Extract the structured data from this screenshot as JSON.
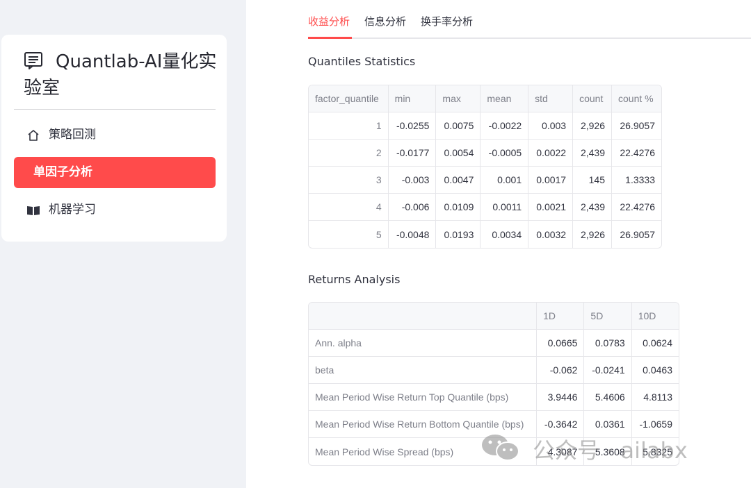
{
  "sidebar": {
    "title": "Quantlab-AI量化实验室",
    "items": [
      {
        "label": "策略回测",
        "icon": "home-icon",
        "active": false
      },
      {
        "label": "单因子分析",
        "icon": "",
        "active": true
      },
      {
        "label": "机器学习",
        "icon": "book-icon",
        "active": false
      }
    ]
  },
  "tabs": [
    {
      "label": "收益分析",
      "active": true
    },
    {
      "label": "信息分析",
      "active": false
    },
    {
      "label": "换手率分析",
      "active": false
    }
  ],
  "quantiles": {
    "title": "Quantiles Statistics",
    "columns": [
      "factor_quantile",
      "min",
      "max",
      "mean",
      "std",
      "count",
      "count %"
    ],
    "rows": [
      [
        "1",
        "-0.0255",
        "0.0075",
        "-0.0022",
        "0.003",
        "2,926",
        "26.9057"
      ],
      [
        "2",
        "-0.0177",
        "0.0054",
        "-0.0005",
        "0.0022",
        "2,439",
        "22.4276"
      ],
      [
        "3",
        "-0.003",
        "0.0047",
        "0.001",
        "0.0017",
        "145",
        "1.3333"
      ],
      [
        "4",
        "-0.006",
        "0.0109",
        "0.0011",
        "0.0021",
        "2,439",
        "22.4276"
      ],
      [
        "5",
        "-0.0048",
        "0.0193",
        "0.0034",
        "0.0032",
        "2,926",
        "26.9057"
      ]
    ]
  },
  "returns": {
    "title": "Returns Analysis",
    "columns": [
      "",
      "1D",
      "5D",
      "10D"
    ],
    "rows": [
      [
        "Ann. alpha",
        "0.0665",
        "0.0783",
        "0.0624"
      ],
      [
        "beta",
        "-0.062",
        "-0.0241",
        "0.0463"
      ],
      [
        "Mean Period Wise Return Top Quantile (bps)",
        "3.9446",
        "5.4606",
        "4.8113"
      ],
      [
        "Mean Period Wise Return Bottom Quantile (bps)",
        "-0.3642",
        "0.0361",
        "-1.0659"
      ],
      [
        "Mean Period Wise Spread (bps)",
        "4.3087",
        "5.3608",
        "5.8325"
      ]
    ]
  },
  "watermark": {
    "text": "公众号 · ailabx",
    "icon": "wechat-icon"
  },
  "colors": {
    "accent": "#ff4b4b",
    "sidebar_bg": "#f0f2f6",
    "text": "#31333f",
    "muted": "#7d7f89",
    "border": "#e6e6ea"
  }
}
